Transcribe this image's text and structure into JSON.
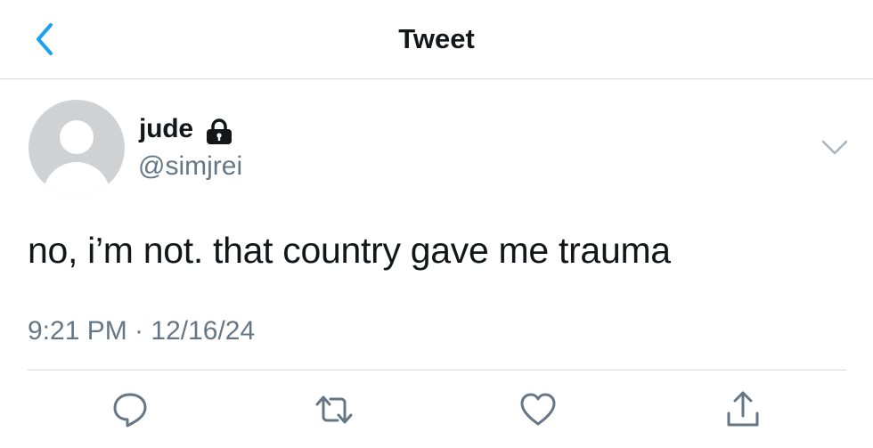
{
  "header": {
    "title": "Tweet",
    "back_icon": "chevron-left-icon",
    "accent_color": "#1da1f2"
  },
  "tweet": {
    "author": {
      "display_name": "jude",
      "handle": "@simjrei",
      "protected_icon": "lock-icon",
      "avatar": "default-avatar"
    },
    "text": "no, i’m not. that country gave me trauma",
    "timestamp": "9:21 PM · 12/16/24",
    "menu_icon": "chevron-down-icon"
  },
  "actions": [
    {
      "name": "reply",
      "icon": "speech-bubble-icon"
    },
    {
      "name": "retweet",
      "icon": "retweet-icon"
    },
    {
      "name": "like",
      "icon": "heart-icon"
    },
    {
      "name": "share",
      "icon": "share-icon"
    }
  ],
  "colors": {
    "text": "#14171a",
    "secondary_text": "#657786",
    "icon_gray": "#657786",
    "divider": "#d6d9db",
    "avatar_bg": "#cfd2d4"
  }
}
